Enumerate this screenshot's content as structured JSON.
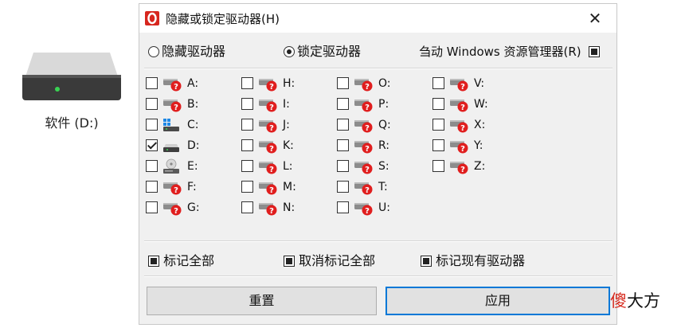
{
  "desktop_icon": {
    "label": "软件 (D:)"
  },
  "dialog": {
    "title": "隐藏或锁定驱动器(H)",
    "close_glyph": "✕",
    "mode_hide_label": "隐藏驱动器",
    "mode_lock_label": "锁定驱动器",
    "selected_mode": "lock",
    "restart_explorer_label": "刍动 Windows 资源管理器(R)",
    "drives": [
      {
        "letter": "A:",
        "checked": false,
        "icon": "locked-drive-icon"
      },
      {
        "letter": "B:",
        "checked": false,
        "icon": "locked-drive-icon"
      },
      {
        "letter": "C:",
        "checked": false,
        "icon": "windows-drive-icon"
      },
      {
        "letter": "D:",
        "checked": true,
        "icon": "hard-drive-icon"
      },
      {
        "letter": "E:",
        "checked": false,
        "icon": "optical-drive-icon"
      },
      {
        "letter": "F:",
        "checked": false,
        "icon": "locked-drive-icon"
      },
      {
        "letter": "G:",
        "checked": false,
        "icon": "locked-drive-icon"
      },
      {
        "letter": "H:",
        "checked": false,
        "icon": "locked-drive-icon"
      },
      {
        "letter": "I:",
        "checked": false,
        "icon": "locked-drive-icon"
      },
      {
        "letter": "J:",
        "checked": false,
        "icon": "locked-drive-icon"
      },
      {
        "letter": "K:",
        "checked": false,
        "icon": "locked-drive-icon"
      },
      {
        "letter": "L:",
        "checked": false,
        "icon": "locked-drive-icon"
      },
      {
        "letter": "M:",
        "checked": false,
        "icon": "locked-drive-icon"
      },
      {
        "letter": "N:",
        "checked": false,
        "icon": "locked-drive-icon"
      },
      {
        "letter": "O:",
        "checked": false,
        "icon": "locked-drive-icon"
      },
      {
        "letter": "P:",
        "checked": false,
        "icon": "locked-drive-icon"
      },
      {
        "letter": "Q:",
        "checked": false,
        "icon": "locked-drive-icon"
      },
      {
        "letter": "R:",
        "checked": false,
        "icon": "locked-drive-icon"
      },
      {
        "letter": "S:",
        "checked": false,
        "icon": "locked-drive-icon"
      },
      {
        "letter": "T:",
        "checked": false,
        "icon": "locked-drive-icon"
      },
      {
        "letter": "U:",
        "checked": false,
        "icon": "locked-drive-icon"
      },
      {
        "letter": "V:",
        "checked": false,
        "icon": "locked-drive-icon"
      },
      {
        "letter": "W:",
        "checked": false,
        "icon": "locked-drive-icon"
      },
      {
        "letter": "X:",
        "checked": false,
        "icon": "locked-drive-icon"
      },
      {
        "letter": "Y:",
        "checked": false,
        "icon": "locked-drive-icon"
      },
      {
        "letter": "Z:",
        "checked": false,
        "icon": "locked-drive-icon"
      }
    ],
    "mark_all_label": "标记全部",
    "unmark_all_label": "取消标记全部",
    "mark_existing_label": "标记现有驱动器",
    "reset_label": "重置",
    "apply_label": "应用"
  },
  "watermark": {
    "first_char": "傻",
    "rest": "大方"
  },
  "colors": {
    "accent": "#0078d7",
    "lock_red": "#e01e1e",
    "watermark_red": "#d62a1e"
  }
}
